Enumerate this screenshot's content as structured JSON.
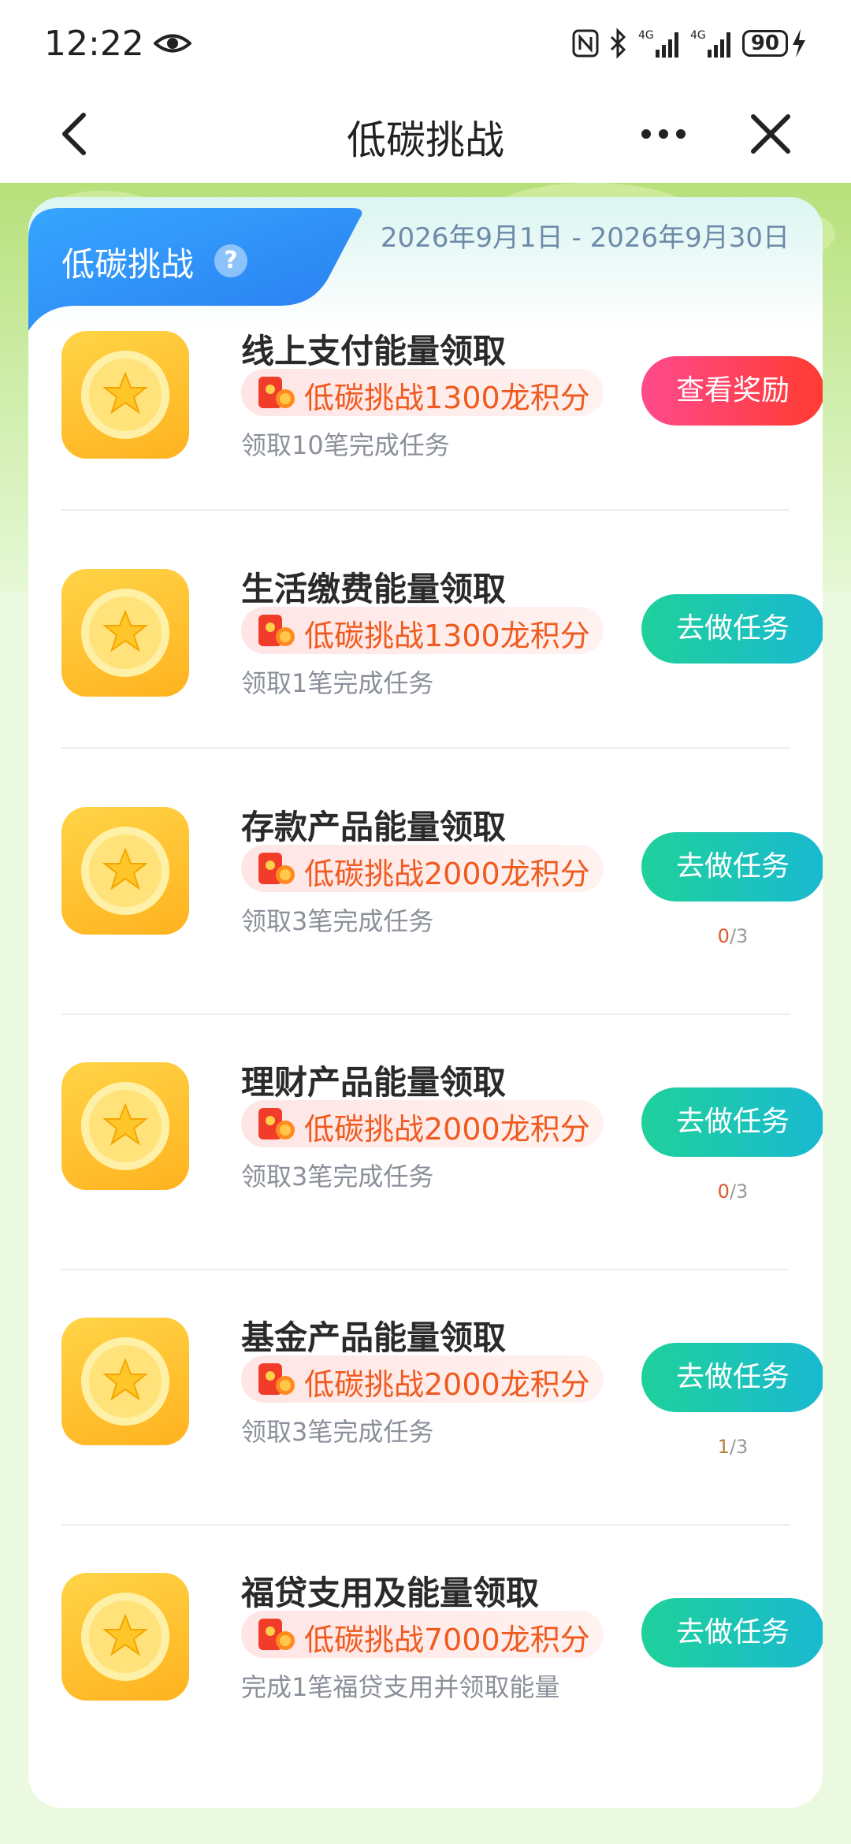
{
  "status": {
    "time": "12:22",
    "battery": "90",
    "sig1": "4G",
    "sig2": "4G"
  },
  "nav": {
    "title": "低碳挑战"
  },
  "card": {
    "tab_label": "低碳挑战",
    "help": "?",
    "date_range": "2026年9月1日 - 2026年9月30日"
  },
  "colors": {
    "primary_button": "#1fd19a",
    "reward_button": "#ff3b30",
    "reward_text": "#f05a1e",
    "tab_blue": "#2a8af5"
  },
  "tasks": [
    {
      "title": "线上支付能量领取",
      "reward": "低碳挑战1300龙积分",
      "desc": "领取10笔完成任务",
      "button": "查看奖励",
      "button_type": "reward",
      "progress_current": "",
      "progress_total": ""
    },
    {
      "title": "生活缴费能量领取",
      "reward": "低碳挑战1300龙积分",
      "desc": "领取1笔完成任务",
      "button": "去做任务",
      "button_type": "task",
      "progress_current": "",
      "progress_total": ""
    },
    {
      "title": "存款产品能量领取",
      "reward": "低碳挑战2000龙积分",
      "desc": "领取3笔完成任务",
      "button": "去做任务",
      "button_type": "task",
      "progress_current": "0",
      "progress_total": "/3"
    },
    {
      "title": "理财产品能量领取",
      "reward": "低碳挑战2000龙积分",
      "desc": "领取3笔完成任务",
      "button": "去做任务",
      "button_type": "task",
      "progress_current": "0",
      "progress_total": "/3"
    },
    {
      "title": "基金产品能量领取",
      "reward": "低碳挑战2000龙积分",
      "desc": "领取3笔完成任务",
      "button": "去做任务",
      "button_type": "task",
      "progress_current": "1",
      "progress_total": "/3"
    },
    {
      "title": "福贷支用及能量领取",
      "reward": "低碳挑战7000龙积分",
      "desc": "完成1笔福贷支用并领取能量",
      "button": "去做任务",
      "button_type": "task",
      "progress_current": "",
      "progress_total": ""
    }
  ]
}
